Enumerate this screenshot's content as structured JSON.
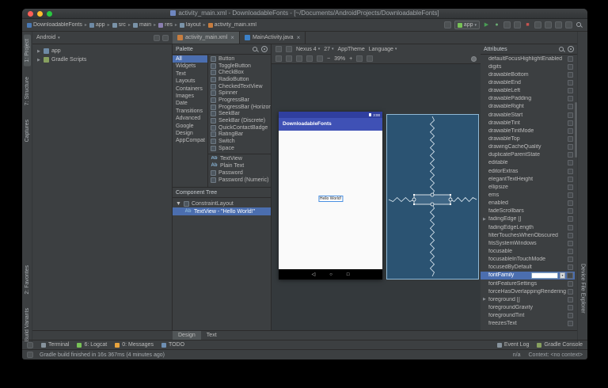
{
  "window": {
    "title": "activity_main.xml - DownloadableFonts - [~/Documents/AndroidProjects/DownloadableFonts]"
  },
  "toolbar": {
    "breadcrumbs": [
      {
        "label": "DownloadableFonts",
        "icon": "project-folder-icon"
      },
      {
        "label": "app",
        "icon": "module-folder-icon"
      },
      {
        "label": "src",
        "icon": "folder-icon"
      },
      {
        "label": "main",
        "icon": "folder-icon"
      },
      {
        "label": "res",
        "icon": "resources-folder-icon"
      },
      {
        "label": "layout",
        "icon": "folder-icon"
      },
      {
        "label": "activity_main.xml",
        "icon": "xml-file-icon"
      }
    ],
    "run_config": "app",
    "icons_left": [
      "hammer-icon"
    ],
    "icons_right": [
      "run-icon",
      "debug-icon",
      "coverage-icon",
      "profiler-icon",
      "stop-icon",
      "attach-debugger-icon",
      "avd-manager-icon",
      "sync-gradle-icon",
      "sdk-manager-icon",
      "search-everywhere-icon"
    ]
  },
  "left_strip": {
    "top": [
      "1: Project",
      "7: Structure",
      "Captures"
    ],
    "bottom": [
      "2: Favorites",
      "Build Variants"
    ]
  },
  "right_strip": {
    "bottom": [
      "Device File Explorer"
    ]
  },
  "project_panel": {
    "view_selector": "Android",
    "items": [
      {
        "label": "app",
        "icon": "module-folder-icon"
      },
      {
        "label": "Gradle Scripts",
        "icon": "gradle-icon"
      }
    ]
  },
  "editor_tabs": [
    {
      "label": "activity_main.xml",
      "icon": "xml-file-icon",
      "selected": true
    },
    {
      "label": "MainActivity.java",
      "icon": "java-class-icon",
      "selected": false
    }
  ],
  "palette": {
    "title": "Palette",
    "header_icons": [
      "search-icon",
      "gear-icon"
    ],
    "categories": [
      "All",
      "Widgets",
      "Text",
      "Layouts",
      "Containers",
      "Images",
      "Date",
      "Transitions",
      "Advanced",
      "Google",
      "Design",
      "AppCompat"
    ],
    "selected_category": "All",
    "components": [
      {
        "label": "Button",
        "icon": "button-icon"
      },
      {
        "label": "ToggleButton",
        "icon": "togglebutton-icon"
      },
      {
        "label": "CheckBox",
        "icon": "checkbox-icon"
      },
      {
        "label": "RadioButton",
        "icon": "radiobutton-icon"
      },
      {
        "label": "CheckedTextView",
        "icon": "checkedtextview-icon"
      },
      {
        "label": "Spinner",
        "icon": "spinner-icon"
      },
      {
        "label": "ProgressBar",
        "icon": "progressbar-icon"
      },
      {
        "label": "ProgressBar (Horizontal)",
        "icon": "progressbar-horizontal-icon"
      },
      {
        "label": "SeekBar",
        "icon": "seekbar-icon"
      },
      {
        "label": "SeekBar (Discrete)",
        "icon": "seekbar-discrete-icon"
      },
      {
        "label": "QuickContactBadge",
        "icon": "quickcontactbadge-icon"
      },
      {
        "label": "RatingBar",
        "icon": "ratingbar-icon"
      },
      {
        "label": "Switch",
        "icon": "switch-icon"
      },
      {
        "label": "Space",
        "icon": "space-icon"
      }
    ],
    "components_text": [
      {
        "label": "TextView",
        "icon": "textview-icon",
        "glyph": "Ab"
      },
      {
        "label": "Plain Text",
        "icon": "plaintext-icon",
        "glyph": "Ab"
      },
      {
        "label": "Password",
        "icon": "password-icon",
        "glyph": ""
      },
      {
        "label": "Password (Numeric)",
        "icon": "password-numeric-icon",
        "glyph": ""
      }
    ]
  },
  "component_tree": {
    "title": "Component Tree",
    "items": [
      {
        "label": "ConstraintLayout",
        "icon": "constraintlayout-icon",
        "depth": 0,
        "selected": false
      },
      {
        "label": "TextView - \"Hello World!\"",
        "icon": "textview-icon",
        "depth": 1,
        "selected": true
      }
    ]
  },
  "design_toolbar": {
    "device": "Nexus 4",
    "api": "27",
    "theme": "AppTheme",
    "language": "Language",
    "zoom": "39%"
  },
  "preview": {
    "app_title": "DownloadableFonts",
    "time": "3:00",
    "hello": "Hello World!",
    "nav_icons": [
      "back-icon",
      "home-icon",
      "recents-icon"
    ],
    "nav_glyphs": [
      "◁",
      "○",
      "□"
    ]
  },
  "attributes": {
    "title": "Attributes",
    "header_icons": [
      "search-icon",
      "gear-icon"
    ],
    "font_family_value": "",
    "rows": [
      {
        "label": "defaultFocusHighlightEnabled"
      },
      {
        "label": "digits"
      },
      {
        "label": "drawableBottom"
      },
      {
        "label": "drawableEnd"
      },
      {
        "label": "drawableLeft"
      },
      {
        "label": "drawablePadding"
      },
      {
        "label": "drawableRight"
      },
      {
        "label": "drawableStart"
      },
      {
        "label": "drawableTint"
      },
      {
        "label": "drawableTintMode"
      },
      {
        "label": "drawableTop"
      },
      {
        "label": "drawingCacheQuality"
      },
      {
        "label": "duplicateParentState"
      },
      {
        "label": "editable"
      },
      {
        "label": "editorExtras"
      },
      {
        "label": "elegantTextHeight"
      },
      {
        "label": "ellipsize"
      },
      {
        "label": "ems"
      },
      {
        "label": "enabled"
      },
      {
        "label": "fadeScrollbars"
      },
      {
        "label": "fadingEdge []",
        "expand": true
      },
      {
        "label": "fadingEdgeLength"
      },
      {
        "label": "filterTouchesWhenObscured"
      },
      {
        "label": "fitsSystemWindows"
      },
      {
        "label": "focusable"
      },
      {
        "label": "focusableInTouchMode"
      },
      {
        "label": "focusedByDefault"
      },
      {
        "label": "fontFamily",
        "editor": true
      },
      {
        "label": "fontFeatureSettings"
      },
      {
        "label": "forceHasOverlappingRendering"
      },
      {
        "label": "foreground []",
        "expand": true
      },
      {
        "label": "foregroundGravity"
      },
      {
        "label": "foregroundTint"
      },
      {
        "label": "freezesText"
      }
    ]
  },
  "bottom_tabs": [
    {
      "label": "Design",
      "selected": true
    },
    {
      "label": "Text",
      "selected": false
    }
  ],
  "toolwindows": {
    "left": [
      {
        "label": "Terminal",
        "icon": "terminal-icon"
      },
      {
        "label": "6: Logcat",
        "icon": "android-icon"
      },
      {
        "label": "0: Messages",
        "icon": "messages-icon"
      },
      {
        "label": "TODO",
        "icon": "todo-icon"
      }
    ],
    "right": [
      {
        "label": "Event Log",
        "icon": "event-log-icon"
      },
      {
        "label": "Gradle Console",
        "icon": "gradle-icon"
      }
    ]
  },
  "status_bar": {
    "message": "Gradle build finished in 16s 367ms (4 minutes ago)",
    "na": "n/a",
    "context": "Context: <no context>"
  },
  "colors": {
    "accent_selection": "#4b6eaf",
    "appbar_blue": "#3F51B5",
    "statusbar_blue": "#303F9F",
    "blueprint_blue": "#2b5372",
    "run_green": "#499c54",
    "stop_red": "#c75450"
  }
}
